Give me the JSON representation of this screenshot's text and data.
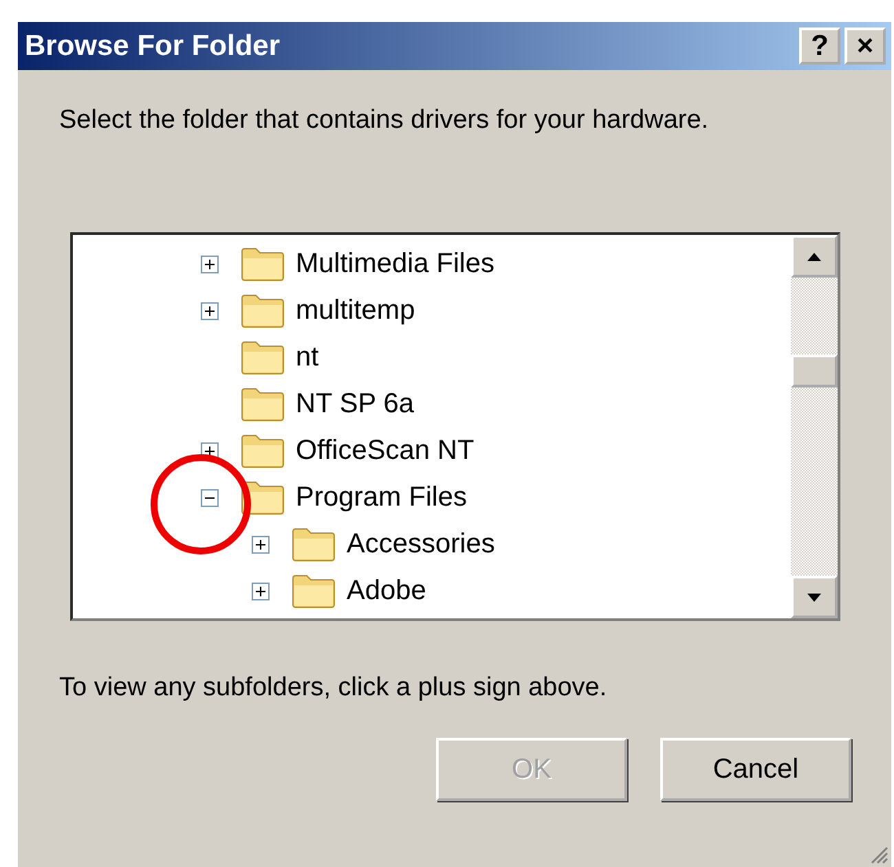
{
  "window": {
    "title": "Browse For Folder",
    "buttons": [
      "?",
      "×"
    ]
  },
  "instruction": "Select the folder that contains drivers for your hardware.",
  "tree": [
    {
      "label": "Multimedia Files",
      "kind": "branch",
      "expanded": false
    },
    {
      "label": "multitemp",
      "kind": "branch",
      "expanded": false
    },
    {
      "label": "nt",
      "kind": "leaf"
    },
    {
      "label": "NT SP 6a",
      "kind": "leaf"
    },
    {
      "label": "OfficeScan NT",
      "kind": "branch",
      "expanded": false
    },
    {
      "label": "Program Files",
      "kind": "branch",
      "expanded": true,
      "highlighted": true,
      "children": [
        {
          "label": "Accessories",
          "kind": "branch",
          "expanded": false
        },
        {
          "label": "Adobe",
          "kind": "branch",
          "expanded": false
        }
      ]
    }
  ],
  "hint": "To view any subfolders, click a plus sign above.",
  "buttons": [
    {
      "label": "OK",
      "disabled": true
    },
    {
      "label": "Cancel",
      "disabled": false
    }
  ]
}
